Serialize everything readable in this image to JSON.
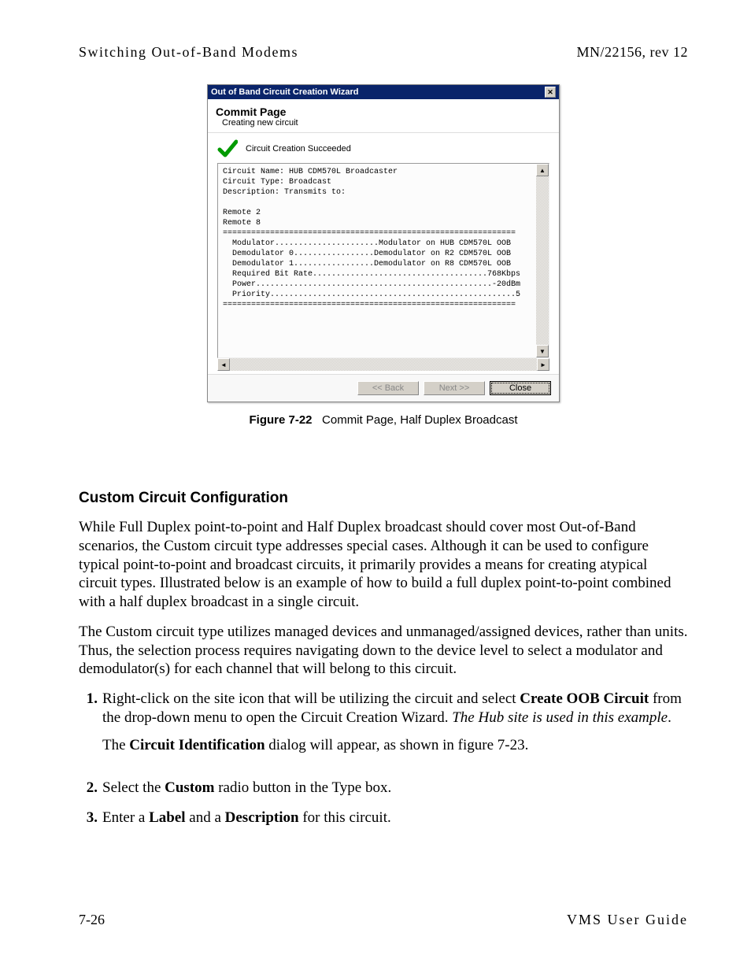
{
  "header": {
    "left": "Switching Out-of-Band Modems",
    "right": "MN/22156, rev 12"
  },
  "wizard": {
    "titlebar": "Out of Band Circuit Creation Wizard",
    "page_title": "Commit Page",
    "page_subtitle": "Creating new circuit",
    "status": "Circuit Creation Succeeded",
    "info": "Circuit Name: HUB CDM570L Broadcaster\nCircuit Type: Broadcast\nDescription: Transmits to:\n\nRemote 2\nRemote 8\n==============================================================\n  Modulator......................Modulator on HUB CDM570L OOB\n  Demodulator 0.................Demodulator on R2 CDM570L OOB\n  Demodulator 1.................Demodulator on R8 CDM570L OOB\n  Required Bit Rate.....................................768Kbps\n  Power..................................................-20dBm\n  Priority....................................................5\n==============================================================",
    "buttons": {
      "back": "<< Back",
      "next": "Next >>",
      "close": "Close"
    }
  },
  "figure": {
    "label": "Figure 7-22",
    "caption": "Commit Page, Half Duplex Broadcast"
  },
  "section": {
    "title": "Custom Circuit Configuration",
    "para1": "While Full Duplex point-to-point and Half Duplex broadcast should cover most Out-of-Band scenarios, the Custom circuit type addresses special cases. Although it can be used to configure typical point-to-point and broadcast circuits, it primarily provides a means for creating atypical circuit types. Illustrated below is an example of how to build a full duplex point-to-point combined with a half duplex broadcast in a single circuit.",
    "para2": "The Custom circuit type utilizes managed devices and unmanaged/assigned devices, rather than units. Thus, the selection process requires navigating down to the device level to select a modulator and demodulator(s) for each channel that will belong to this circuit."
  },
  "steps": {
    "s1_a": "Right-click on the site icon that will be utilizing the circuit and select ",
    "s1_b": "Create OOB Circuit",
    "s1_c": " from the drop-down menu to open the Circuit Creation Wizard. ",
    "s1_d": "The Hub site is used in this example",
    "s1_e": ".",
    "s1_sub_a": "The ",
    "s1_sub_b": "Circuit Identification",
    "s1_sub_c": " dialog will appear, as shown in figure 7-23.",
    "s2_a": "Select the ",
    "s2_b": "Custom",
    "s2_c": " radio button in the Type box.",
    "s3_a": "Enter a ",
    "s3_b": "Label",
    "s3_c": " and a ",
    "s3_d": "Description",
    "s3_e": " for this circuit."
  },
  "footer": {
    "left": "7-26",
    "right": "VMS User Guide"
  }
}
